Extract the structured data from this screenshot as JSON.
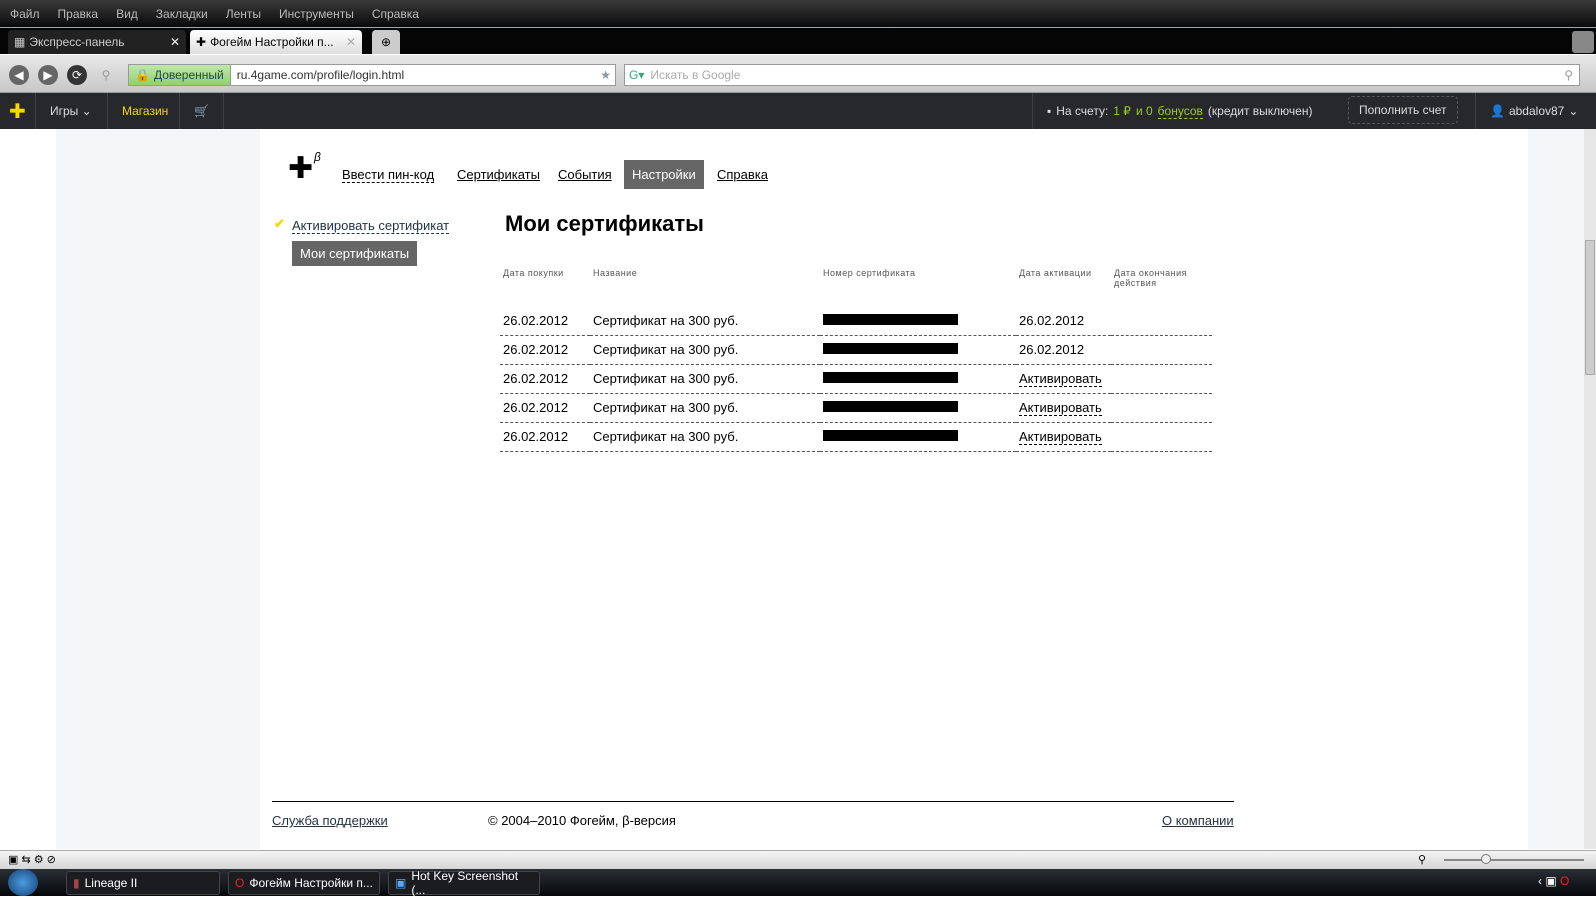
{
  "browser": {
    "menu": [
      "Файл",
      "Правка",
      "Вид",
      "Закладки",
      "Ленты",
      "Инструменты",
      "Справка"
    ],
    "tabs": [
      {
        "label": "Экспресс-панель"
      },
      {
        "label": "Фогейм Настройки п..."
      }
    ],
    "secure_label": "Доверенный",
    "url": "ru.4game.com/profile/login.html",
    "search_placeholder": "Искать в Google"
  },
  "site_header": {
    "games": "Игры",
    "shop": "Магазин",
    "balance_prefix": "На счету:",
    "balance_amount": "1 ₽",
    "balance_and": "и 0",
    "bonuses": "бонусов",
    "credit": "(кредит выключен)",
    "topup": "Пополнить счет",
    "username": "abdalov87"
  },
  "nav": {
    "beta": "β",
    "items": [
      "Ввести пин-код",
      "Сертификаты",
      "События",
      "Настройки",
      "Справка"
    ],
    "active": "Настройки"
  },
  "sidebar": {
    "activate": "Активировать сертификат",
    "mine": "Мои сертификаты"
  },
  "main": {
    "title": "Мои сертификаты",
    "columns": [
      "Дата покупки",
      "Название",
      "Номер сертификата",
      "Дата активации",
      "Дата окончания действия"
    ],
    "rows": [
      {
        "date": "26.02.2012",
        "name": "Сертификат на 300 руб.",
        "activation": "26.02.2012"
      },
      {
        "date": "26.02.2012",
        "name": "Сертификат на 300 руб.",
        "activation": "26.02.2012"
      },
      {
        "date": "26.02.2012",
        "name": "Сертификат на 300 руб.",
        "activation": "Активировать"
      },
      {
        "date": "26.02.2012",
        "name": "Сертификат на 300 руб.",
        "activation": "Активировать"
      },
      {
        "date": "26.02.2012",
        "name": "Сертификат на 300 руб.",
        "activation": "Активировать"
      }
    ]
  },
  "footer": {
    "support": "Служба поддержки",
    "copyright": "© 2004–2010 Фогейм, β-версия",
    "about": "О компании"
  },
  "taskbar": [
    "Lineage II",
    "Фогейм Настройки п...",
    "Hot Key Screenshot (..."
  ],
  "colors": {
    "accent_yellow": "#f5d800",
    "balance_green": "#9ccc2c",
    "active_tab": "#666666"
  }
}
